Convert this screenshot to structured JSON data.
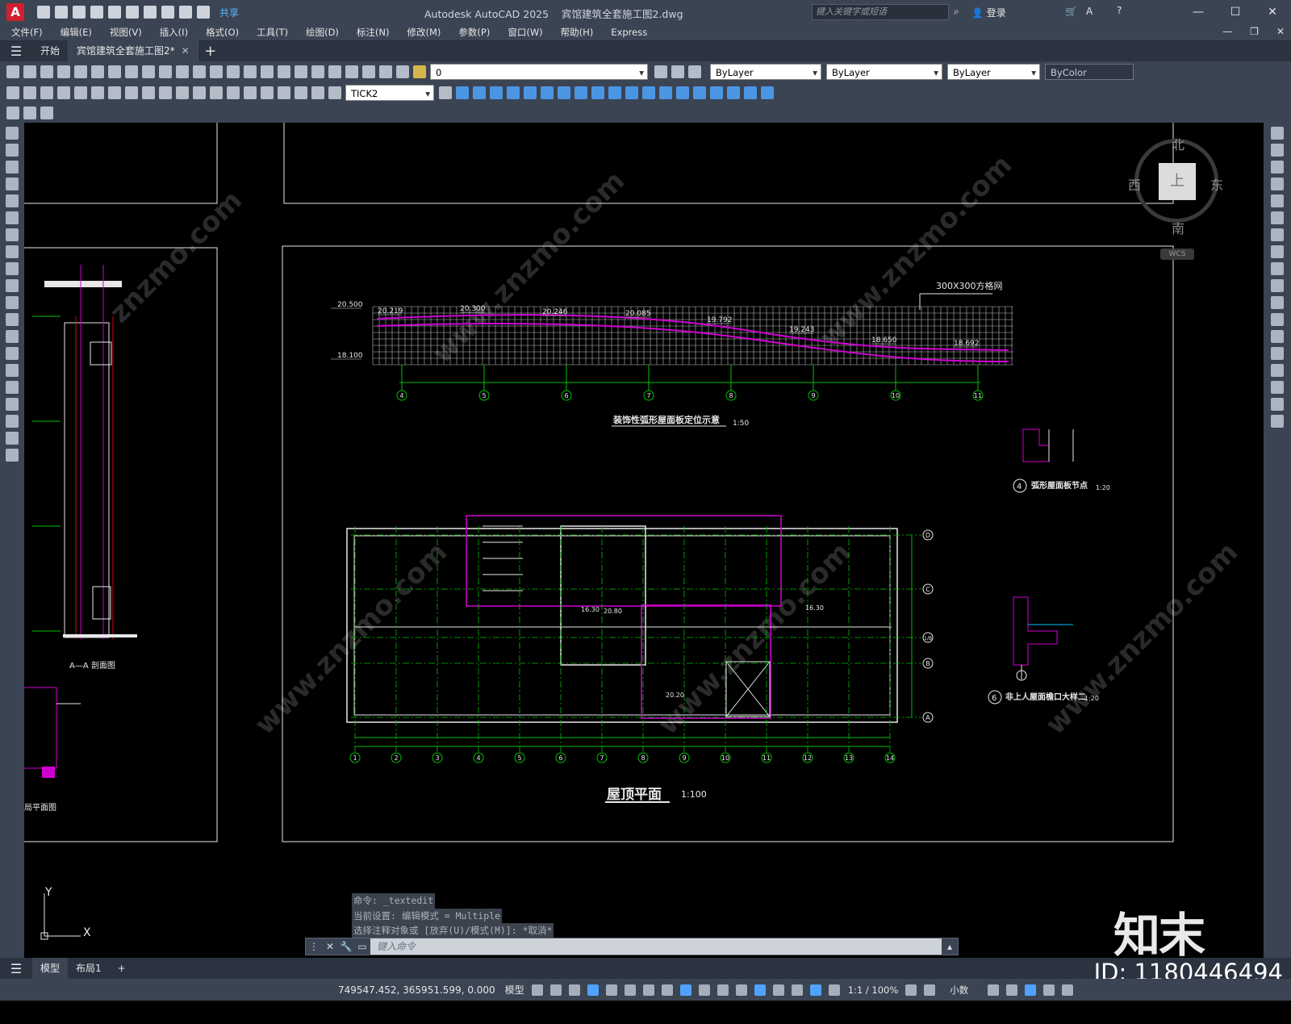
{
  "app": {
    "logo": "A",
    "title": "Autodesk AutoCAD 2025",
    "filename": "宾馆建筑全套施工图2.dwg",
    "share_label": "共享",
    "search_placeholder": "键入关键字或短语",
    "login_label": "登录"
  },
  "menu": {
    "items": [
      "文件(F)",
      "编辑(E)",
      "视图(V)",
      "插入(I)",
      "格式(O)",
      "工具(T)",
      "绘图(D)",
      "标注(N)",
      "修改(M)",
      "参数(P)",
      "窗口(W)",
      "帮助(H)",
      "Express"
    ]
  },
  "tabs": {
    "start": "开始",
    "doc": "宾馆建筑全套施工图2*"
  },
  "toolbar": {
    "layer_value": "0",
    "color_value": "ByLayer",
    "linetype_value": "ByLayer",
    "lineweight_value": "ByLayer",
    "plotstyle_value": "ByColor",
    "dimstyle_value": "TICK2"
  },
  "viewcube": {
    "north": "北",
    "south": "南",
    "east": "东",
    "west": "西",
    "face": "上",
    "wcs": "WCS"
  },
  "drawing": {
    "section_title": "A—A 剖面图",
    "partial_plan_title": "局平面图",
    "arc_title": "装饰性弧形屋面板定位示意",
    "arc_scale": "1:50",
    "grid_note": "300X300方格网",
    "arc_elevations": [
      "20.500",
      "18.100",
      "20.219",
      "20.300",
      "20.246",
      "20.085",
      "19.792",
      "19.243",
      "18.650",
      "18.692"
    ],
    "arc_axes": [
      "4",
      "5",
      "6",
      "7",
      "8",
      "9",
      "10",
      "11"
    ],
    "detail4_num": "4",
    "detail4_title": "弧形屋面板节点",
    "detail4_scale": "1:20",
    "detail6_num": "6",
    "detail6_title": "非上人屋面檐口大样二",
    "detail6_scale": "1:20",
    "roof_title": "屋顶平面",
    "roof_scale": "1:100",
    "roof_axes_x": [
      "1",
      "2",
      "3",
      "4",
      "5",
      "6",
      "7",
      "8",
      "9",
      "10",
      "11",
      "12",
      "13",
      "14"
    ],
    "roof_axes_y": [
      "D",
      "C",
      "1/B",
      "B",
      "A"
    ],
    "roof_elevations": [
      "16.30",
      "20.80",
      "16.30",
      "20.20"
    ]
  },
  "command": {
    "history": [
      "命令: _textedit",
      "当前设置: 编辑模式 = Multiple",
      "选择注释对象或 [放弃(U)/模式(M)]: *取消*"
    ],
    "placeholder": "键入命令"
  },
  "layouts": {
    "model": "模型",
    "layout1": "布局1"
  },
  "status": {
    "coords": "749547.452, 365951.599, 0.000",
    "model": "模型",
    "scale": "1:1 / 100%",
    "units": "小数"
  },
  "watermark": {
    "logo": "知末",
    "id": "ID: 1180446494"
  },
  "colors": {
    "ui_bg": "#3b4453",
    "grid": "#c8c8c8",
    "arc": "#d000d0",
    "axis": "#00c000",
    "wall": "#e8e8e8",
    "accent": "#4fa3ff"
  }
}
